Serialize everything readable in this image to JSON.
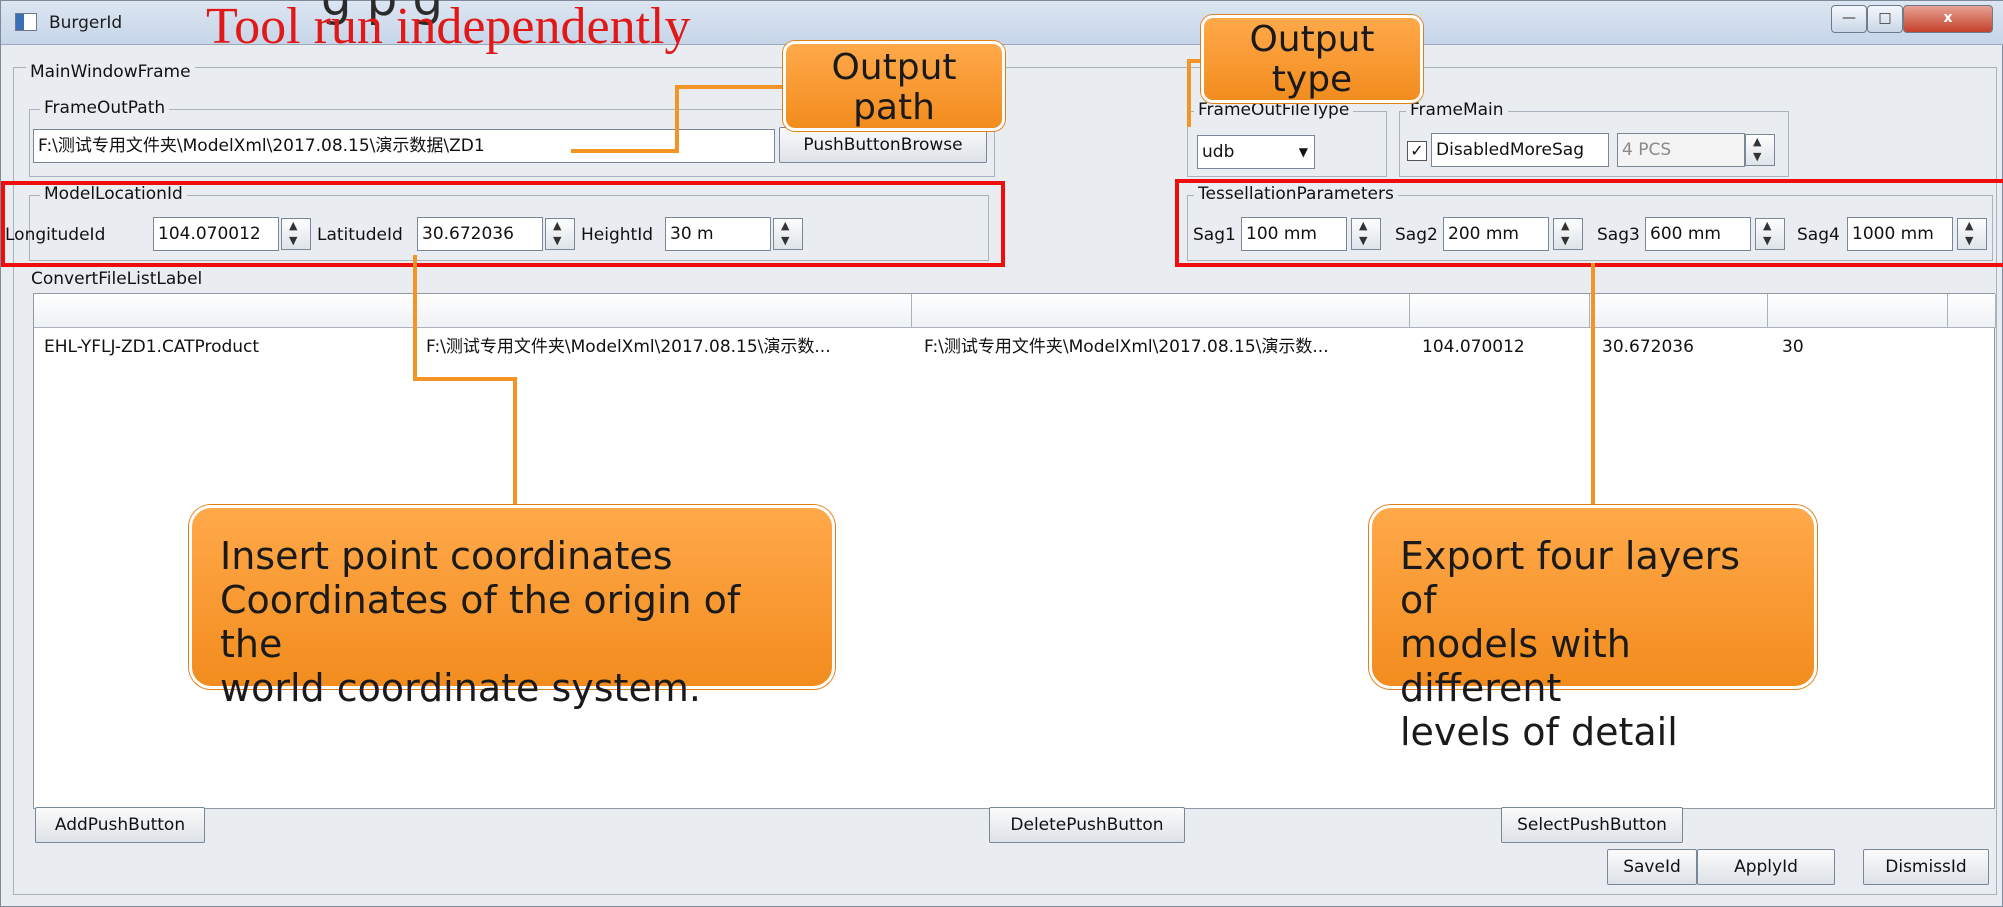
{
  "window": {
    "title": "BurgerId",
    "overlay_title": "Tool run independently",
    "overlay_top_text": "g  p  g",
    "minimize": "—",
    "maximize": "□",
    "close": "x"
  },
  "main_frame": {
    "label": "MainWindowFrame"
  },
  "out_path": {
    "label": "FrameOutPath",
    "value": "F:\\测试专用文件夹\\ModelXml\\2017.08.15\\演示数据\\ZD1",
    "browse_button": "PushButtonBrowse"
  },
  "out_type": {
    "label": "FrameOutFileType",
    "value": "udb"
  },
  "frame_main": {
    "label": "FrameMain",
    "checkbox_label": "DisabledMoreSag",
    "checked": true,
    "pcs_value": "4 PCS"
  },
  "model_location": {
    "label": "ModelLocationId",
    "longitude_label": "LongitudeId",
    "longitude_value": "104.070012",
    "latitude_label": "LatitudeId",
    "latitude_value": "30.672036",
    "height_label": "HeightId",
    "height_value": "30 m"
  },
  "tessellation": {
    "label": "TessellationParameters",
    "sag1_label": "Sag1",
    "sag1_value": "100 mm",
    "sag2_label": "Sag2",
    "sag2_value": "200 mm",
    "sag3_label": "Sag3",
    "sag3_value": "600 mm",
    "sag4_label": "Sag4",
    "sag4_value": "1000 mm"
  },
  "file_list": {
    "label": "ConvertFileListLabel",
    "row": {
      "name": "EHL-YFLJ-ZD1.CATProduct",
      "source": "F:\\测试专用文件夹\\ModelXml\\2017.08.15\\演示数...",
      "target": "F:\\测试专用文件夹\\ModelXml\\2017.08.15\\演示数...",
      "longitude": "104.070012",
      "latitude": "30.672036",
      "height": "30"
    }
  },
  "buttons": {
    "add": "AddPushButton",
    "delete": "DeletePushButton",
    "select": "SelectPushButton",
    "save": "SaveId",
    "apply": "ApplyId",
    "dismiss": "DismissId"
  },
  "callouts": {
    "output_path_1": "Output",
    "output_path_2": "path",
    "output_type_1": "Output",
    "output_type_2": "type",
    "coords_1": "Insert point coordinates",
    "coords_2": "Coordinates of the origin of the",
    "coords_3": "world coordinate system.",
    "lod_1": "Export four layers of",
    "lod_2": "models with different",
    "lod_3": "levels of detail"
  },
  "colors": {
    "annotation_red": "#ef0d0d",
    "callout_orange": "#f39526",
    "title_overlay_red": "#e01818"
  }
}
